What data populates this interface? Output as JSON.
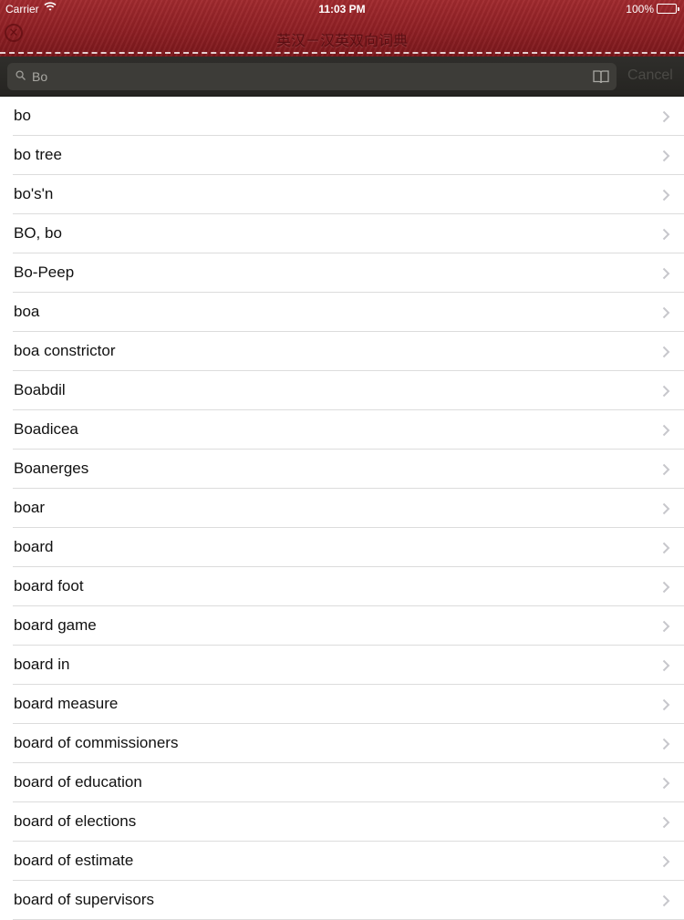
{
  "status_bar": {
    "carrier": "Carrier",
    "time": "11:03 PM",
    "battery": "100%"
  },
  "header": {
    "title": "英汉－汉英双向词典",
    "close_icon": "close-circle-icon"
  },
  "search": {
    "value": "Bo",
    "icons": [
      "search-icon",
      "book-icon"
    ],
    "cancel_label": "Cancel"
  },
  "colors": {
    "header_red": "#8f1f24",
    "search_bar": "#2a2926",
    "title_text": "#5a0d11"
  },
  "results": [
    "bo",
    "bo tree",
    "bo's'n",
    "BO, bo",
    "Bo-Peep",
    "boa",
    "boa constrictor",
    "Boabdil",
    "Boadicea",
    "Boanerges",
    "boar",
    "board",
    "board foot",
    "board game",
    "board in",
    "board measure",
    "board of commissioners",
    "board of education",
    "board of elections",
    "board of estimate",
    "board of supervisors"
  ]
}
